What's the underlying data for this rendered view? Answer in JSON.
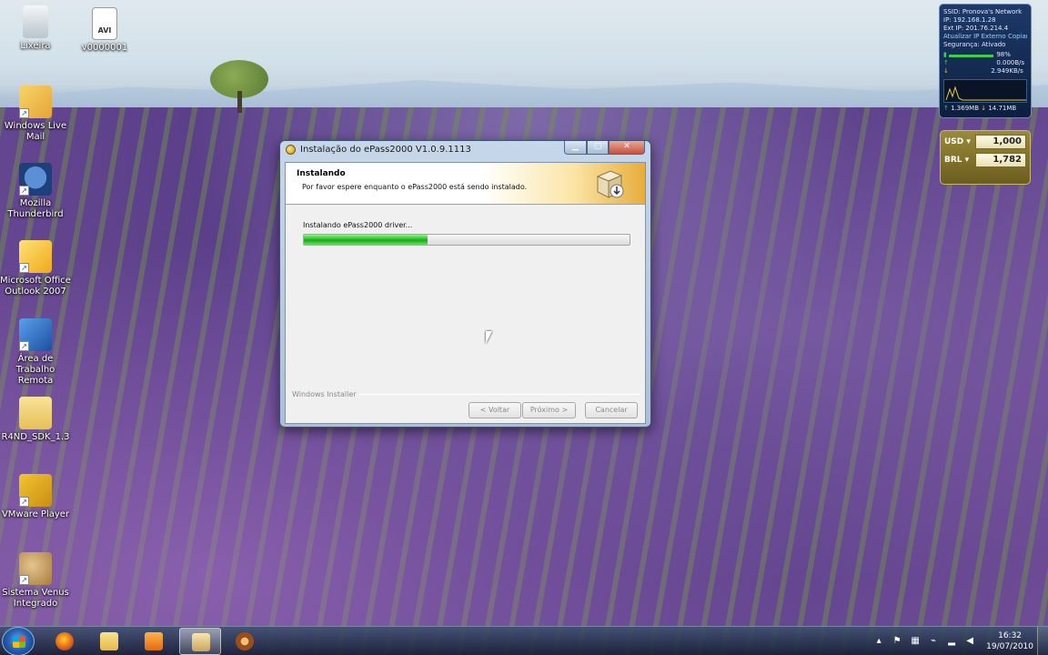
{
  "desktop": {
    "icons": [
      {
        "label": "Lixeira",
        "icon": "recycle-bin-icon"
      },
      {
        "label": "v0000001",
        "icon": "avi-file-icon",
        "badge": "AVI"
      },
      {
        "label": "Windows Live Mail",
        "icon": "windows-live-mail-icon"
      },
      {
        "label": "Mozilla Thunderbird",
        "icon": "thunderbird-icon"
      },
      {
        "label": "Microsoft Office Outlook 2007",
        "icon": "outlook-icon"
      },
      {
        "label": "Área de Trabalho Remota",
        "icon": "remote-desktop-icon"
      },
      {
        "label": "R4ND_SDK_1.3",
        "icon": "folder-icon"
      },
      {
        "label": "VMware Player",
        "icon": "vmware-icon"
      },
      {
        "label": "Sistema Venus Integrado",
        "icon": "venus-icon"
      }
    ]
  },
  "network_gadget": {
    "ssid": "SSID: Pronova's Network",
    "ip": "IP: 192.168.1.28",
    "ext_ip": "Ext IP: 201.76.214.4",
    "refresh_link": "Atualizar IP Externo",
    "copy_link": "Copiar",
    "security": "Segurança: Ativado",
    "signal": "98%",
    "signal_level": 0.98,
    "upload": "0.000B/s",
    "download": "2.949KB/s",
    "sent": "1.369MB",
    "received": "14.71MB"
  },
  "currency_gadget": {
    "rows": [
      {
        "code": "USD",
        "value": "1,000"
      },
      {
        "code": "BRL",
        "value": "1,782"
      }
    ]
  },
  "installer": {
    "title": "Instalação do ePass2000 V1.0.9.1113",
    "header_title": "Instalando",
    "header_subtitle": "Por favor espere enquanto o ePass2000 está sendo instalado.",
    "status": "Instalando ePass2000 driver...",
    "progress": 0.38,
    "brand": "Windows Installer",
    "back_label": "< Voltar",
    "next_label": "Próximo >",
    "cancel_label": "Cancelar"
  },
  "taskbar": {
    "apps": [
      {
        "name": "firefox",
        "icon": "firefox-icon",
        "active": false
      },
      {
        "name": "explorer",
        "icon": "folder-icon",
        "active": false
      },
      {
        "name": "media-player",
        "icon": "media-player-icon",
        "active": false
      },
      {
        "name": "installer",
        "icon": "installer-icon",
        "active": true
      },
      {
        "name": "film-app",
        "icon": "film-reel-icon",
        "active": false
      }
    ],
    "tray_icons": [
      "show-hidden-icon",
      "flag-icon",
      "network-icon",
      "usb-icon",
      "wifi-icon",
      "volume-icon"
    ],
    "time": "16:32",
    "date": "19/07/2010"
  },
  "colors": {
    "progress_green": "#25c226",
    "header_gradient_end": "#e7ad3c",
    "taskbar_bg": "#1e2a40"
  }
}
